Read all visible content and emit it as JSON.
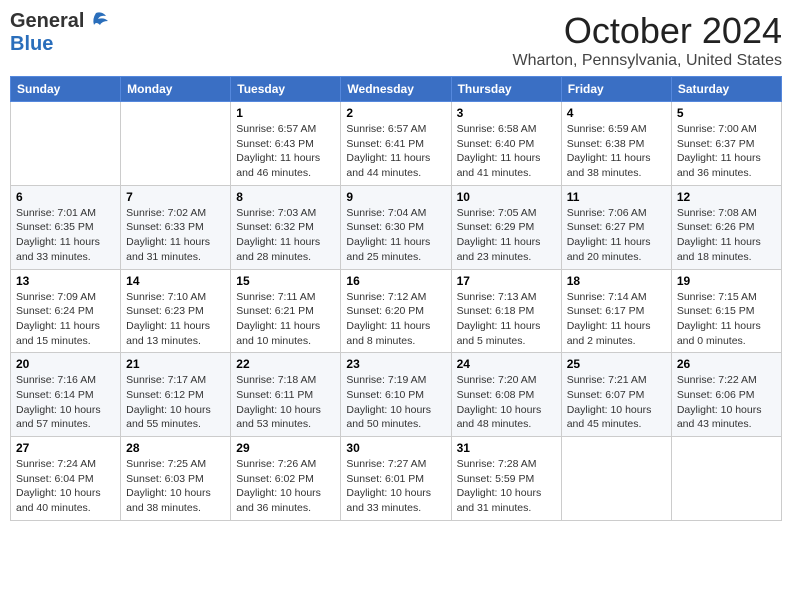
{
  "header": {
    "logo_general": "General",
    "logo_blue": "Blue",
    "month": "October 2024",
    "location": "Wharton, Pennsylvania, United States"
  },
  "weekdays": [
    "Sunday",
    "Monday",
    "Tuesday",
    "Wednesday",
    "Thursday",
    "Friday",
    "Saturday"
  ],
  "weeks": [
    [
      {
        "day": "",
        "info": ""
      },
      {
        "day": "",
        "info": ""
      },
      {
        "day": "1",
        "info": "Sunrise: 6:57 AM\nSunset: 6:43 PM\nDaylight: 11 hours and 46 minutes."
      },
      {
        "day": "2",
        "info": "Sunrise: 6:57 AM\nSunset: 6:41 PM\nDaylight: 11 hours and 44 minutes."
      },
      {
        "day": "3",
        "info": "Sunrise: 6:58 AM\nSunset: 6:40 PM\nDaylight: 11 hours and 41 minutes."
      },
      {
        "day": "4",
        "info": "Sunrise: 6:59 AM\nSunset: 6:38 PM\nDaylight: 11 hours and 38 minutes."
      },
      {
        "day": "5",
        "info": "Sunrise: 7:00 AM\nSunset: 6:37 PM\nDaylight: 11 hours and 36 minutes."
      }
    ],
    [
      {
        "day": "6",
        "info": "Sunrise: 7:01 AM\nSunset: 6:35 PM\nDaylight: 11 hours and 33 minutes."
      },
      {
        "day": "7",
        "info": "Sunrise: 7:02 AM\nSunset: 6:33 PM\nDaylight: 11 hours and 31 minutes."
      },
      {
        "day": "8",
        "info": "Sunrise: 7:03 AM\nSunset: 6:32 PM\nDaylight: 11 hours and 28 minutes."
      },
      {
        "day": "9",
        "info": "Sunrise: 7:04 AM\nSunset: 6:30 PM\nDaylight: 11 hours and 25 minutes."
      },
      {
        "day": "10",
        "info": "Sunrise: 7:05 AM\nSunset: 6:29 PM\nDaylight: 11 hours and 23 minutes."
      },
      {
        "day": "11",
        "info": "Sunrise: 7:06 AM\nSunset: 6:27 PM\nDaylight: 11 hours and 20 minutes."
      },
      {
        "day": "12",
        "info": "Sunrise: 7:08 AM\nSunset: 6:26 PM\nDaylight: 11 hours and 18 minutes."
      }
    ],
    [
      {
        "day": "13",
        "info": "Sunrise: 7:09 AM\nSunset: 6:24 PM\nDaylight: 11 hours and 15 minutes."
      },
      {
        "day": "14",
        "info": "Sunrise: 7:10 AM\nSunset: 6:23 PM\nDaylight: 11 hours and 13 minutes."
      },
      {
        "day": "15",
        "info": "Sunrise: 7:11 AM\nSunset: 6:21 PM\nDaylight: 11 hours and 10 minutes."
      },
      {
        "day": "16",
        "info": "Sunrise: 7:12 AM\nSunset: 6:20 PM\nDaylight: 11 hours and 8 minutes."
      },
      {
        "day": "17",
        "info": "Sunrise: 7:13 AM\nSunset: 6:18 PM\nDaylight: 11 hours and 5 minutes."
      },
      {
        "day": "18",
        "info": "Sunrise: 7:14 AM\nSunset: 6:17 PM\nDaylight: 11 hours and 2 minutes."
      },
      {
        "day": "19",
        "info": "Sunrise: 7:15 AM\nSunset: 6:15 PM\nDaylight: 11 hours and 0 minutes."
      }
    ],
    [
      {
        "day": "20",
        "info": "Sunrise: 7:16 AM\nSunset: 6:14 PM\nDaylight: 10 hours and 57 minutes."
      },
      {
        "day": "21",
        "info": "Sunrise: 7:17 AM\nSunset: 6:12 PM\nDaylight: 10 hours and 55 minutes."
      },
      {
        "day": "22",
        "info": "Sunrise: 7:18 AM\nSunset: 6:11 PM\nDaylight: 10 hours and 53 minutes."
      },
      {
        "day": "23",
        "info": "Sunrise: 7:19 AM\nSunset: 6:10 PM\nDaylight: 10 hours and 50 minutes."
      },
      {
        "day": "24",
        "info": "Sunrise: 7:20 AM\nSunset: 6:08 PM\nDaylight: 10 hours and 48 minutes."
      },
      {
        "day": "25",
        "info": "Sunrise: 7:21 AM\nSunset: 6:07 PM\nDaylight: 10 hours and 45 minutes."
      },
      {
        "day": "26",
        "info": "Sunrise: 7:22 AM\nSunset: 6:06 PM\nDaylight: 10 hours and 43 minutes."
      }
    ],
    [
      {
        "day": "27",
        "info": "Sunrise: 7:24 AM\nSunset: 6:04 PM\nDaylight: 10 hours and 40 minutes."
      },
      {
        "day": "28",
        "info": "Sunrise: 7:25 AM\nSunset: 6:03 PM\nDaylight: 10 hours and 38 minutes."
      },
      {
        "day": "29",
        "info": "Sunrise: 7:26 AM\nSunset: 6:02 PM\nDaylight: 10 hours and 36 minutes."
      },
      {
        "day": "30",
        "info": "Sunrise: 7:27 AM\nSunset: 6:01 PM\nDaylight: 10 hours and 33 minutes."
      },
      {
        "day": "31",
        "info": "Sunrise: 7:28 AM\nSunset: 5:59 PM\nDaylight: 10 hours and 31 minutes."
      },
      {
        "day": "",
        "info": ""
      },
      {
        "day": "",
        "info": ""
      }
    ]
  ]
}
